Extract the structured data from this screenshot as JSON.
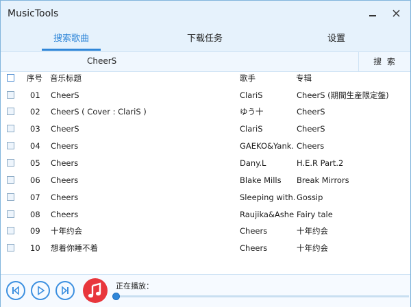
{
  "window": {
    "title": "MusicTools",
    "minimize_icon": "minus-icon",
    "close_icon": "close-icon"
  },
  "tabs": [
    {
      "label": "搜索歌曲",
      "active": true
    },
    {
      "label": "下载任务",
      "active": false
    },
    {
      "label": "设置",
      "active": false
    }
  ],
  "search": {
    "value": "CheerS",
    "button_label": "搜 索"
  },
  "table": {
    "headers": {
      "index": "序号",
      "title": "音乐标题",
      "artist": "歌手",
      "album": "专辑"
    },
    "rows": [
      {
        "index": "01",
        "title": "CheerS",
        "artist": "ClariS",
        "album": "CheerS (期間生産限定盤)"
      },
      {
        "index": "02",
        "title": "CheerS ( Cover : ClariS )",
        "artist": "ゆう十",
        "album": "CheerS"
      },
      {
        "index": "03",
        "title": "CheerS",
        "artist": "ClariS",
        "album": "CheerS"
      },
      {
        "index": "04",
        "title": "Cheers",
        "artist": "GAEKO&Yank...",
        "album": "Cheers"
      },
      {
        "index": "05",
        "title": "Cheers",
        "artist": "Dany.L",
        "album": "H.E.R Part.2"
      },
      {
        "index": "06",
        "title": "Cheers",
        "artist": "Blake Mills",
        "album": "Break Mirrors"
      },
      {
        "index": "07",
        "title": "Cheers",
        "artist": "Sleeping with...",
        "album": "Gossip"
      },
      {
        "index": "08",
        "title": "Cheers",
        "artist": "Raujika&Ashe...",
        "album": "Fairy tale"
      },
      {
        "index": "09",
        "title": "十年约会",
        "artist": "Cheers",
        "album": "十年约会"
      },
      {
        "index": "10",
        "title": "想着你睡不着",
        "artist": "Cheers",
        "album": "十年约会"
      }
    ]
  },
  "player": {
    "now_playing_label": "正在播放：",
    "progress": 0,
    "icons": [
      "previous-icon",
      "play-icon",
      "next-icon",
      "music-note-icon"
    ]
  },
  "colors": {
    "accent": "#2f86d8",
    "header_bg": "#e6f2fc",
    "logo_red": "#e8363c"
  }
}
